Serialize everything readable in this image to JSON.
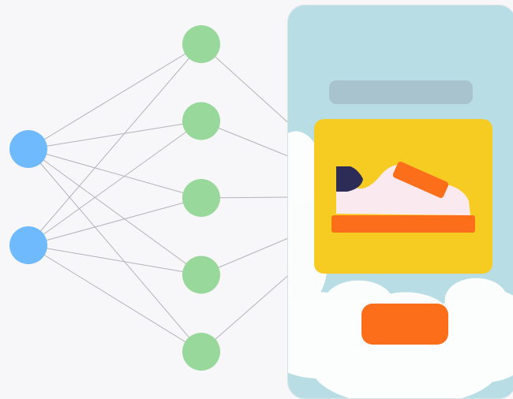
{
  "colors": {
    "background": "#f7f7fa",
    "input_node": "#6fbafc",
    "hidden_node": "#98d89a",
    "edge": "#b3b3b8",
    "phone_sky": "#b8dde4",
    "cloud": "#ffffff",
    "skeleton_bar": "#a8c3cd",
    "card": "#f6cc23",
    "shoe_body": "#fbe9f0",
    "shoe_heel": "#2c2c56",
    "accent_orange": "#fd6e1b"
  },
  "network": {
    "input_layer_count": 2,
    "hidden_layer_count": 5,
    "connectivity": "fully-connected"
  },
  "mockup": {
    "icons": [
      "sneaker-icon"
    ],
    "skeleton_bar_text": "",
    "button_label": ""
  }
}
